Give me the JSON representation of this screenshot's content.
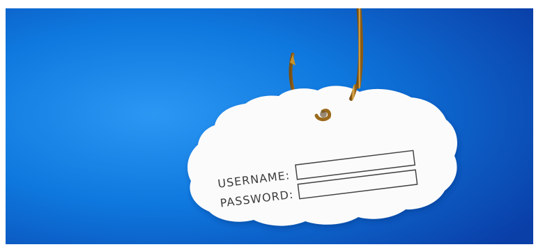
{
  "scene": {
    "colors": {
      "background_light": "#1f8ef0",
      "background_mid": "#0b6fd9",
      "background_dark": "#0a3fa8",
      "paper": "#fbfbfb",
      "hook": "#c8932a",
      "form_text": "#3c3c3c"
    },
    "hook_icon": "fishing-hook-icon",
    "paper_note": {
      "username_label": "USERNAME:",
      "password_label": "PASSWORD:"
    }
  }
}
